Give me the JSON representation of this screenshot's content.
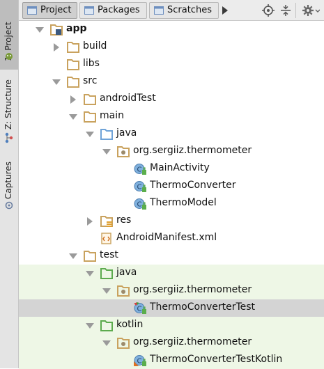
{
  "side_tabs": [
    {
      "label": "1: Project",
      "active": true
    },
    {
      "label": "Z: Structure",
      "active": false
    },
    {
      "label": "Captures",
      "active": false
    }
  ],
  "toolbar": {
    "tabs": [
      {
        "label": "Project",
        "active": true
      },
      {
        "label": "Packages",
        "active": false
      },
      {
        "label": "Scratches",
        "active": false
      }
    ]
  },
  "tree": [
    {
      "label": "app",
      "indent": 0,
      "expanded": true,
      "icon": "module-folder-icon",
      "bold": true
    },
    {
      "label": "build",
      "indent": 1,
      "expanded": false,
      "icon": "folder-icon"
    },
    {
      "label": "libs",
      "indent": 1,
      "icon": "folder-icon"
    },
    {
      "label": "src",
      "indent": 1,
      "expanded": true,
      "icon": "folder-icon"
    },
    {
      "label": "androidTest",
      "indent": 2,
      "expanded": false,
      "icon": "folder-icon"
    },
    {
      "label": "main",
      "indent": 2,
      "expanded": true,
      "icon": "folder-icon"
    },
    {
      "label": "java",
      "indent": 3,
      "expanded": true,
      "icon": "source-folder-icon"
    },
    {
      "label": "org.sergiiz.thermometer",
      "indent": 4,
      "expanded": true,
      "icon": "package-icon"
    },
    {
      "label": "MainActivity",
      "indent": 5,
      "icon": "class-icon"
    },
    {
      "label": "ThermoConverter",
      "indent": 5,
      "icon": "class-icon"
    },
    {
      "label": "ThermoModel",
      "indent": 5,
      "icon": "class-icon"
    },
    {
      "label": "res",
      "indent": 3,
      "expanded": false,
      "icon": "resource-folder-icon"
    },
    {
      "label": "AndroidManifest.xml",
      "indent": 3,
      "icon": "manifest-icon"
    },
    {
      "label": "test",
      "indent": 2,
      "expanded": true,
      "icon": "folder-icon"
    },
    {
      "label": "java",
      "indent": 3,
      "expanded": true,
      "icon": "test-folder-icon",
      "tested": true
    },
    {
      "label": "org.sergiiz.thermometer",
      "indent": 4,
      "expanded": true,
      "icon": "package-icon",
      "tested": true
    },
    {
      "label": "ThermoConverterTest",
      "indent": 5,
      "icon": "test-class-icon",
      "tested": true,
      "selected": true
    },
    {
      "label": "kotlin",
      "indent": 3,
      "expanded": true,
      "icon": "test-folder-icon",
      "tested": true
    },
    {
      "label": "org.sergiiz.thermometer",
      "indent": 4,
      "expanded": true,
      "icon": "package-icon",
      "tested": true
    },
    {
      "label": "ThermoConverterTestKotlin",
      "indent": 5,
      "icon": "kotlin-test-icon",
      "tested": true
    }
  ],
  "colors": {
    "folder": "#c9a25e",
    "source_folder": "#6fa3d8",
    "test_folder": "#5cab4e",
    "class_icon": "#7fb0dd",
    "tested_row": "#eef7e6",
    "selected_row": "#d4d4d4"
  }
}
